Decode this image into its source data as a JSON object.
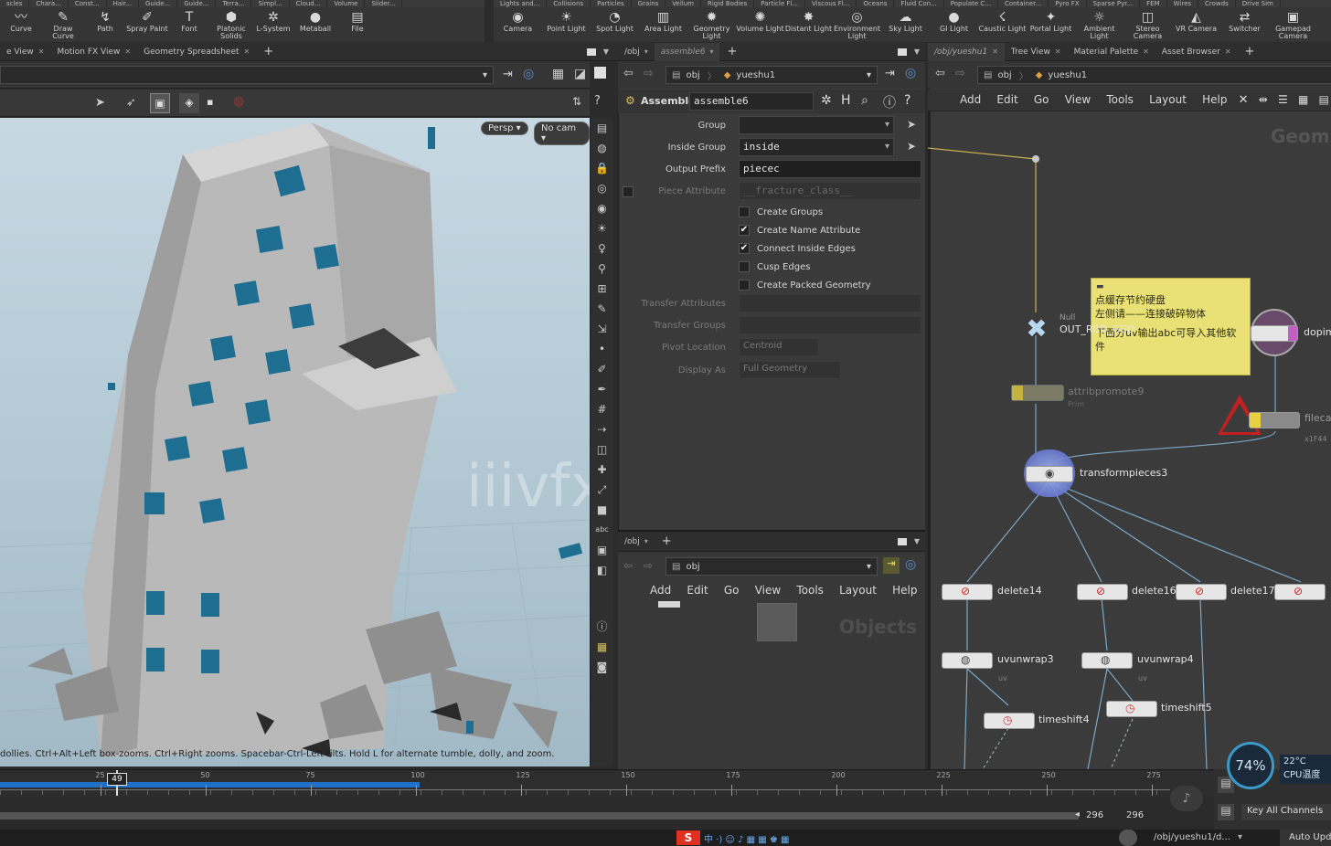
{
  "shelf_tabs_left": [
    "scles",
    "Chara...",
    "Const...",
    "Hair...",
    "Guide...",
    "Guide...",
    "Terra...",
    "Simpl...",
    "Cloud...",
    "Volume",
    "Slider..."
  ],
  "shelf_tabs_right": [
    "Lights and...",
    "Collisions",
    "Particles",
    "Grains",
    "Vellum",
    "Rigid Bodies",
    "Particle Fl...",
    "Viscous Fl...",
    "Oceans",
    "Fluid Con...",
    "Populate C...",
    "Container...",
    "Pyro FX",
    "Sparse Pyr...",
    "FEM",
    "Wires",
    "Crowds",
    "Drive Sim"
  ],
  "shelf_left_tools": [
    {
      "icon": "curve-icon",
      "glyph": "〰",
      "label": "Curve"
    },
    {
      "icon": "draw-curve-icon",
      "glyph": "✎",
      "label": "Draw Curve"
    },
    {
      "icon": "path-icon",
      "glyph": "↯",
      "label": "Path"
    },
    {
      "icon": "spray-paint-icon",
      "glyph": "✐",
      "label": "Spray Paint"
    },
    {
      "icon": "font-icon",
      "glyph": "T",
      "label": "Font"
    },
    {
      "icon": "platonic-solids-icon",
      "glyph": "⬢",
      "label": "Platonic\nSolids"
    },
    {
      "icon": "l-system-icon",
      "glyph": "✲",
      "label": "L-System"
    },
    {
      "icon": "metaball-icon",
      "glyph": "●",
      "label": "Metaball"
    },
    {
      "icon": "file-icon",
      "glyph": "▤",
      "label": "File"
    }
  ],
  "shelf_right_tools": [
    {
      "icon": "camera-icon",
      "glyph": "◉",
      "label": "Camera"
    },
    {
      "icon": "point-light-icon",
      "glyph": "☀",
      "label": "Point Light"
    },
    {
      "icon": "spot-light-icon",
      "glyph": "◔",
      "label": "Spot Light"
    },
    {
      "icon": "area-light-icon",
      "glyph": "▥",
      "label": "Area Light"
    },
    {
      "icon": "geometry-light-icon",
      "glyph": "✹",
      "label": "Geometry\nLight"
    },
    {
      "icon": "volume-light-icon",
      "glyph": "✺",
      "label": "Volume Light"
    },
    {
      "icon": "distant-light-icon",
      "glyph": "✸",
      "label": "Distant Light"
    },
    {
      "icon": "environment-light-icon",
      "glyph": "◎",
      "label": "Environment\nLight"
    },
    {
      "icon": "sky-light-icon",
      "glyph": "☁",
      "label": "Sky Light"
    },
    {
      "icon": "gi-light-icon",
      "glyph": "●",
      "label": "GI Light"
    },
    {
      "icon": "caustic-light-icon",
      "glyph": "☇",
      "label": "Caustic Light"
    },
    {
      "icon": "portal-light-icon",
      "glyph": "✦",
      "label": "Portal Light"
    },
    {
      "icon": "ambient-light-icon",
      "glyph": "☼",
      "label": "Ambient Light"
    },
    {
      "icon": "stereo-camera-icon",
      "glyph": "◫",
      "label": "Stereo\nCamera"
    },
    {
      "icon": "vr-camera-icon",
      "glyph": "◭",
      "label": "VR Camera"
    },
    {
      "icon": "switcher-icon",
      "glyph": "⇄",
      "label": "Switcher"
    },
    {
      "icon": "gamepad-camera-icon",
      "glyph": "▣",
      "label": "Gamepad\nCamera"
    }
  ],
  "left_tabs": [
    "e View",
    "Motion FX View",
    "Geometry Spreadsheet"
  ],
  "viewport": {
    "persp_label": "Persp ▾",
    "cam_label": "No cam ▾",
    "status": "dollies. Ctrl+Alt+Left box-zooms. Ctrl+Right zooms. Spacebar-Ctrl-Left tilts. Hold L for alternate tumble, dolly, and zoom.",
    "watermark": "iiivfx.com"
  },
  "mid": {
    "tabs": [
      "/obj",
      "assemble6"
    ],
    "path_root": "obj",
    "path_node": "yueshu1",
    "op_type": "Assemble",
    "op_name": "assemble6",
    "params": {
      "group_label": "Group",
      "group_value": "",
      "inside_group_label": "Inside Group",
      "inside_group_value": "inside",
      "output_prefix_label": "Output Prefix",
      "output_prefix_value": "piecec",
      "piece_attr_label": "Piece Attribute",
      "piece_attr_value": "__fracture_class__",
      "transfer_attr_label": "Transfer Attributes",
      "transfer_groups_label": "Transfer Groups",
      "pivot_label": "Pivot Location",
      "pivot_value": "Centroid",
      "display_label": "Display As",
      "display_value": "Full Geometry"
    },
    "checkboxes": [
      {
        "label": "Create Groups",
        "checked": false
      },
      {
        "label": "Create Name Attribute",
        "checked": true
      },
      {
        "label": "Connect Inside Edges",
        "checked": true
      },
      {
        "label": "Cusp Edges",
        "checked": false
      },
      {
        "label": "Create Packed Geometry",
        "checked": false
      }
    ],
    "lower_tab": "/obj",
    "lower_path": "obj",
    "lower_menu": [
      "Add",
      "Edit",
      "Go",
      "View",
      "Tools",
      "Layout",
      "Help"
    ],
    "lower_watermark": "Objects"
  },
  "net": {
    "tabs": [
      "/obj/yueshu1",
      "Tree View",
      "Material Palette",
      "Asset Browser"
    ],
    "path_root": "obj",
    "path_node": "yueshu1",
    "menu": [
      "Add",
      "Edit",
      "Go",
      "View",
      "Tools",
      "Layout",
      "Help"
    ],
    "context_label": "Geom",
    "sticky_lines": [
      "点缓存节约硬盘",
      "左侧请——连接破碎物体",
      "",
      "下面分uv输出abc可导入其他软件"
    ],
    "nodes": {
      "null_type": "Null",
      "null_name": "OUT_RBD_GEO",
      "attribpromote": "attribpromote9",
      "attribpromote_sub": "Prim",
      "transformpieces": "transformpieces3",
      "dop": "dopim",
      "filecache": "filecache",
      "filecache_sub": "x1F44",
      "delete14": "delete14",
      "delete16": "delete16",
      "delete17": "delete17",
      "uvunwrap3": "uvunwrap3",
      "uvunwrap4": "uvunwrap4",
      "uv_sub": "uv",
      "timeshift4": "timeshift4",
      "timeshift5": "timeshift5"
    }
  },
  "timeline": {
    "current_frame": "49",
    "ticks": [
      "25",
      "50",
      "75",
      "100",
      "125",
      "150",
      "175",
      "200",
      "225",
      "250",
      "275"
    ],
    "end_a": "296",
    "end_b": "296",
    "key_all": "Key All Channels",
    "cpu_percent": "74%",
    "cpu_temp": "22°C",
    "cpu_label": "CPU温度",
    "channels_label": "/obj/yueshu1/d...",
    "auto_update": "Auto Upd"
  },
  "colors": {
    "accent_blue": "#1f6fc8",
    "sticky_yellow": "#eae176",
    "window_blue": "#1e6e92",
    "node_error_red": "#d02020"
  }
}
